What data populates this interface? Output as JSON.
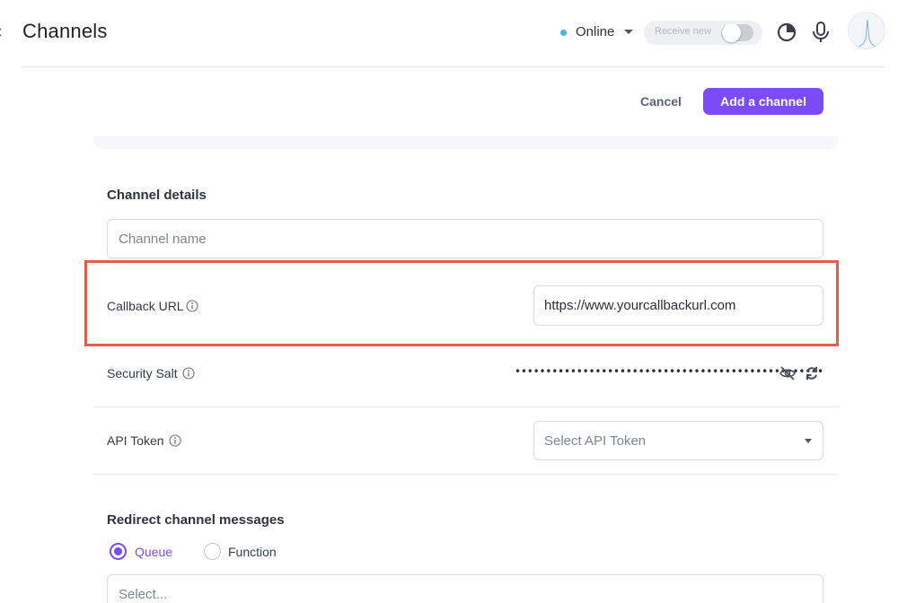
{
  "header": {
    "title": "Channels",
    "status": {
      "label": "Online",
      "dot_color": "#3fb7e3"
    },
    "receive_toggle": {
      "label": "Receive new",
      "on": false
    },
    "icons": [
      "arrow-left-icon",
      "pie-chart-icon",
      "microphone-icon"
    ]
  },
  "actions": {
    "cancel_label": "Cancel",
    "add_label": "Add a channel",
    "accent_color": "#7b4cf6"
  },
  "channel_details": {
    "section_title": "Channel details",
    "channel_name": {
      "value": "",
      "placeholder": "Channel name"
    },
    "callback_url": {
      "label": "Callback URL",
      "value": "https://www.yourcallbackurl.com"
    },
    "security_salt": {
      "label": "Security Salt",
      "masked_value": "••••••••••••••••••••••••••••••••••••••••••••••••••"
    },
    "api_token": {
      "label": "API Token",
      "placeholder": "Select API Token"
    }
  },
  "redirect": {
    "section_title": "Redirect channel messages",
    "options": [
      "Queue",
      "Function"
    ],
    "selected": "Queue",
    "select_placeholder": "Select..."
  },
  "highlight_color": "#ea5a52"
}
